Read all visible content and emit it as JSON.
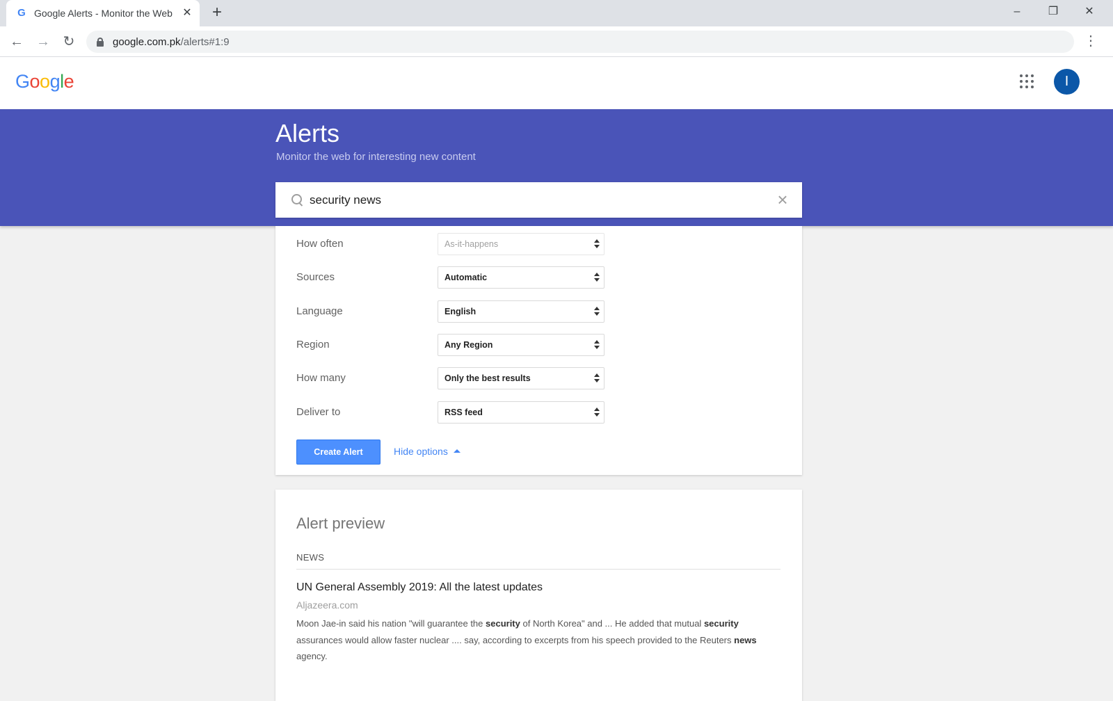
{
  "browser": {
    "tab_title": "Google Alerts - Monitor the Web",
    "favicon": "G",
    "new_tab_glyph": "+",
    "url_host": "google.com.pk",
    "url_path": "/alerts#1:9"
  },
  "header": {
    "logo_letters": [
      "G",
      "o",
      "o",
      "g",
      "l",
      "e"
    ],
    "avatar_initial": "I"
  },
  "hero": {
    "title": "Alerts",
    "subtitle": "Monitor the web for interesting new content"
  },
  "search": {
    "query": "security news"
  },
  "options": [
    {
      "label": "How often",
      "value": "As-it-happens",
      "disabled": true
    },
    {
      "label": "Sources",
      "value": "Automatic",
      "disabled": false
    },
    {
      "label": "Language",
      "value": "English",
      "disabled": false
    },
    {
      "label": "Region",
      "value": "Any Region",
      "disabled": false
    },
    {
      "label": "How many",
      "value": "Only the best results",
      "disabled": false
    },
    {
      "label": "Deliver to",
      "value": "RSS feed",
      "disabled": false
    }
  ],
  "actions": {
    "create_label": "Create Alert",
    "hide_options_label": "Hide options"
  },
  "preview": {
    "heading": "Alert preview",
    "section": "NEWS",
    "items": [
      {
        "title": "UN General Assembly 2019: All the latest updates",
        "source": "Aljazeera.com",
        "snippet_parts": [
          {
            "text": "Moon Jae-in said his nation \"will guarantee the ",
            "bold": false
          },
          {
            "text": "security",
            "bold": true
          },
          {
            "text": " of North Korea\" and ... He added that mutual ",
            "bold": false
          },
          {
            "text": "security",
            "bold": true
          },
          {
            "text": " assurances would allow faster nuclear .... say, according to excerpts from his speech provided to the Reuters ",
            "bold": false
          },
          {
            "text": "news",
            "bold": true
          },
          {
            "text": " agency.",
            "bold": false
          }
        ]
      }
    ]
  },
  "colors": {
    "band": "#4a54b8",
    "primary_button": "#4d90fe",
    "link": "#4285f4",
    "avatar": "#0b57a8"
  }
}
